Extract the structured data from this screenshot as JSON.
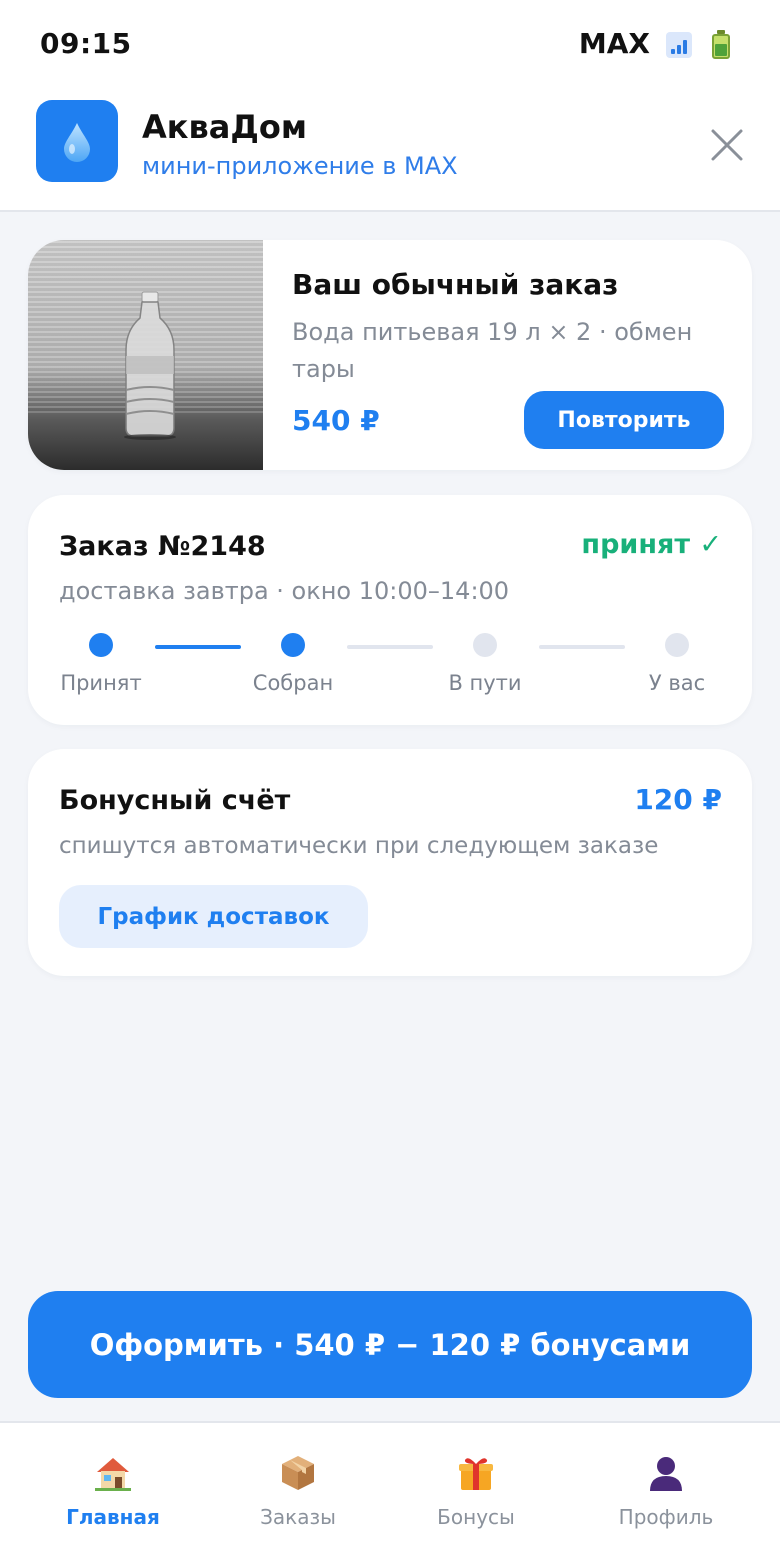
{
  "status_bar": {
    "time": "09:15",
    "carrier": "MAX",
    "icons": [
      "signal-icon",
      "battery-icon"
    ]
  },
  "app_header": {
    "name": "АкваДом",
    "subtitle": "мини-приложение в MAX",
    "logo_icon": "water-drop-icon",
    "close_icon": "close-icon"
  },
  "repeat_order": {
    "title": "Ваш обычный заказ",
    "description": "Вода питьевая 19 л × 2 · обмен тары",
    "price": "540 ₽",
    "button_label": "Повторить",
    "image": "water-bottle-photo"
  },
  "current_order": {
    "title": "Заказ №2148",
    "status": "принят ✓",
    "subtitle": "доставка завтра · окно 10:00–14:00",
    "steps": [
      {
        "label": "Принят",
        "done": true
      },
      {
        "label": "Собран",
        "done": true
      },
      {
        "label": "В пути",
        "done": false
      },
      {
        "label": "У вас",
        "done": false
      }
    ]
  },
  "bonus": {
    "title": "Бонусный счёт",
    "amount": "120 ₽",
    "subtitle": "спишутся автоматически при следующем заказе",
    "button_label": "График доставок"
  },
  "checkout": {
    "label": "Оформить · 540 ₽ − 120 ₽ бонусами"
  },
  "tabs": [
    {
      "label": "Главная",
      "icon": "house-icon",
      "active": true
    },
    {
      "label": "Заказы",
      "icon": "package-icon",
      "active": false
    },
    {
      "label": "Бонусы",
      "icon": "gift-icon",
      "active": false
    },
    {
      "label": "Профиль",
      "icon": "user-icon",
      "active": false
    }
  ],
  "colors": {
    "accent": "#1f7ff0",
    "success": "#18b07a",
    "muted": "#848b96",
    "background": "#f3f5f9",
    "inactive_step": "#e1e5ee"
  }
}
